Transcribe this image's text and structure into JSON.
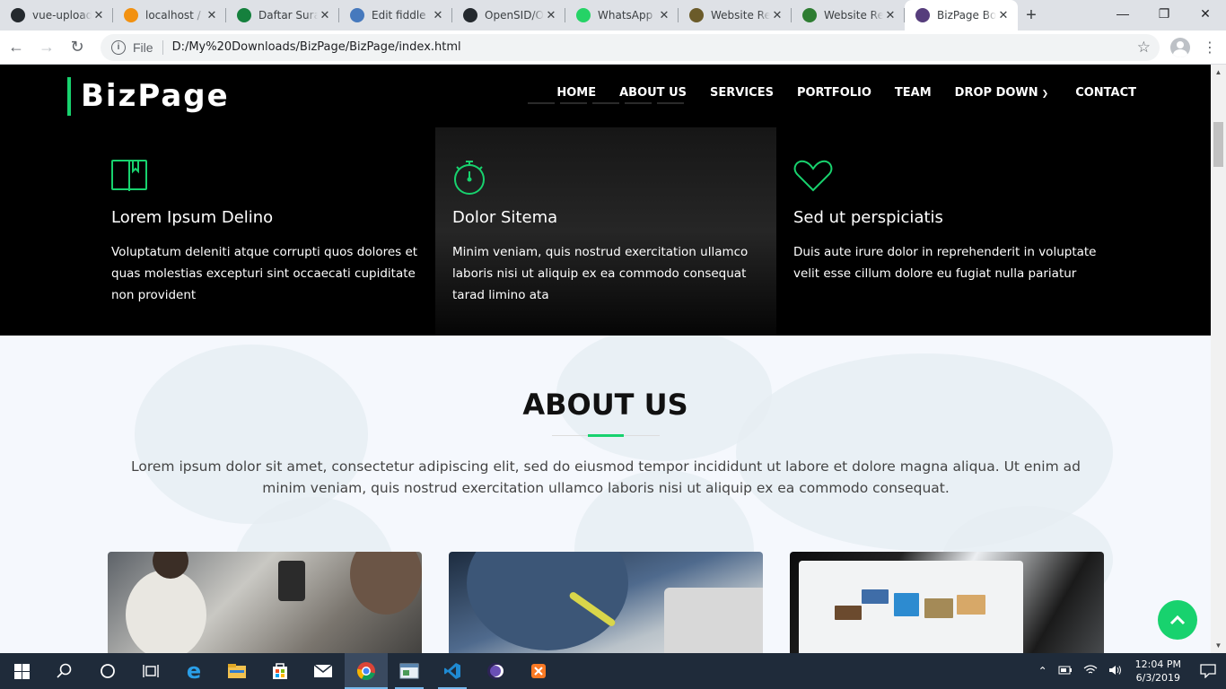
{
  "browser": {
    "tabs": [
      {
        "title": "vue-upload",
        "favicon": "github-icon",
        "color": "#24292e",
        "active": false
      },
      {
        "title": "localhost /",
        "favicon": "phpmyadmin-icon",
        "color": "#f29111",
        "active": false
      },
      {
        "title": "Daftar Surat",
        "favicon": "mountain-icon",
        "color": "#15803d",
        "active": false
      },
      {
        "title": "Edit fiddle",
        "favicon": "jsfiddle-cloud-icon",
        "color": "#4679bd",
        "active": false
      },
      {
        "title": "OpenSID/O",
        "favicon": "github-icon",
        "color": "#24292e",
        "active": false
      },
      {
        "title": "WhatsApp",
        "favicon": "whatsapp-icon",
        "color": "#25d366",
        "active": false
      },
      {
        "title": "Website Re",
        "favicon": "emblem-icon",
        "color": "#6b5b2a",
        "active": false
      },
      {
        "title": "Website Re",
        "favicon": "shield-icon",
        "color": "#2e7d32",
        "active": false
      },
      {
        "title": "BizPage Bo",
        "favicon": "bootstrap-icon",
        "color": "#563d7c",
        "active": true
      }
    ],
    "new_tab": "+",
    "scheme": "File",
    "url": "D:/My%20Downloads/BizPage/BizPage/index.html"
  },
  "site": {
    "logo": "BizPage",
    "accent": "#18d26e",
    "nav": [
      "HOME",
      "ABOUT US",
      "SERVICES",
      "PORTFOLIO",
      "TEAM",
      "DROP DOWN",
      "CONTACT"
    ],
    "features": [
      {
        "icon": "book-icon",
        "title": "Lorem Ipsum Delino",
        "text": "Voluptatum deleniti atque corrupti quos dolores et quas molestias excepturi sint occaecati cupiditate non provident"
      },
      {
        "icon": "stopwatch-icon",
        "title": "Dolor Sitema",
        "text": "Minim veniam, quis nostrud exercitation ullamco laboris nisi ut aliquip ex ea commodo consequat tarad limino ata"
      },
      {
        "icon": "heart-icon",
        "title": "Sed ut perspiciatis",
        "text": "Duis aute irure dolor in reprehenderit in voluptate velit esse cillum dolore eu fugiat nulla pariatur"
      }
    ],
    "about": {
      "title": "ABOUT US",
      "lead": "Lorem ipsum dolor sit amet, consectetur adipiscing elit, sed do eiusmod tempor incididunt ut labore et dolore magna aliqua. Ut enim ad minim veniam, quis nostrud exercitation ullamco laboris nisi ut aliquip ex ea commodo consequat."
    }
  },
  "taskbar": {
    "apps": [
      "start-icon",
      "search-icon",
      "cortana-icon",
      "task-view-icon",
      "edge-icon",
      "file-explorer-icon",
      "store-icon",
      "mail-icon",
      "chrome-icon",
      "app-window-icon",
      "vscode-icon",
      "eclipse-icon",
      "xampp-icon"
    ],
    "time": "12:04 PM",
    "date": "6/3/2019"
  }
}
